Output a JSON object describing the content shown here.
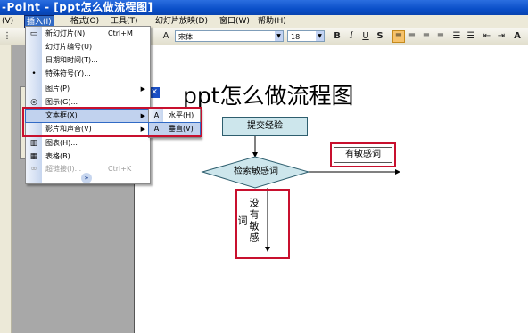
{
  "window": {
    "title": "-Point - [ppt怎么做流程图]"
  },
  "menubar": {
    "edge_label": "(V)",
    "items": [
      "插入(I)",
      "格式(O)",
      "工具(T)",
      "幻灯片放映(D)",
      "窗口(W)",
      "帮助(H)"
    ]
  },
  "toolbar": {
    "font_name": "宋体",
    "font_size": "18",
    "bold": "B",
    "italic": "I",
    "underline": "U",
    "shadow": "S",
    "grow_font": "A"
  },
  "insert_menu": {
    "items": [
      {
        "label": "新幻灯片(N)",
        "shortcut": "Ctrl+M",
        "icon": "new-slide-icon",
        "submenu": false,
        "disabled": false
      },
      {
        "label": "幻灯片编号(U)",
        "shortcut": "",
        "icon": "",
        "submenu": false,
        "disabled": false
      },
      {
        "label": "日期和时间(T)...",
        "shortcut": "",
        "icon": "",
        "submenu": false,
        "disabled": false
      },
      {
        "label": "特殊符号(Y)...",
        "shortcut": "",
        "icon": "symbol-icon",
        "submenu": false,
        "disabled": false
      },
      {
        "label": "图片(P)",
        "shortcut": "",
        "icon": "",
        "submenu": true,
        "disabled": false
      },
      {
        "label": "图示(G)...",
        "shortcut": "",
        "icon": "diagram-icon",
        "submenu": false,
        "disabled": false
      },
      {
        "label": "文本框(X)",
        "shortcut": "",
        "icon": "",
        "submenu": true,
        "disabled": false
      },
      {
        "label": "影片和声音(V)",
        "shortcut": "",
        "icon": "",
        "submenu": true,
        "disabled": false
      },
      {
        "label": "图表(H)...",
        "shortcut": "",
        "icon": "chart-icon",
        "submenu": false,
        "disabled": false
      },
      {
        "label": "表格(B)...",
        "shortcut": "",
        "icon": "table-icon",
        "submenu": false,
        "disabled": false
      },
      {
        "label": "超链接(I)...",
        "shortcut": "Ctrl+K",
        "icon": "hyperlink-icon",
        "submenu": false,
        "disabled": true
      }
    ],
    "expand_glyph": "»"
  },
  "textbox_submenu": {
    "items": [
      {
        "label": "水平(H)",
        "icon": "horizontal-textbox-icon"
      },
      {
        "label": "垂直(V)",
        "icon": "vertical-textbox-icon"
      }
    ]
  },
  "slide": {
    "title": "ppt怎么做流程图",
    "flow": {
      "start_box": "提交经验",
      "decision": "检索敏感词",
      "yes_box": "有敏感词",
      "no_box": "没有敏感词"
    }
  },
  "colors": {
    "title_bar": "#0a4fc8",
    "menu_highlight": "#c1d2ee",
    "annotation_red": "#c8102e",
    "shape_fill": "#cde6ec",
    "shape_stroke": "#2e5e6e"
  }
}
